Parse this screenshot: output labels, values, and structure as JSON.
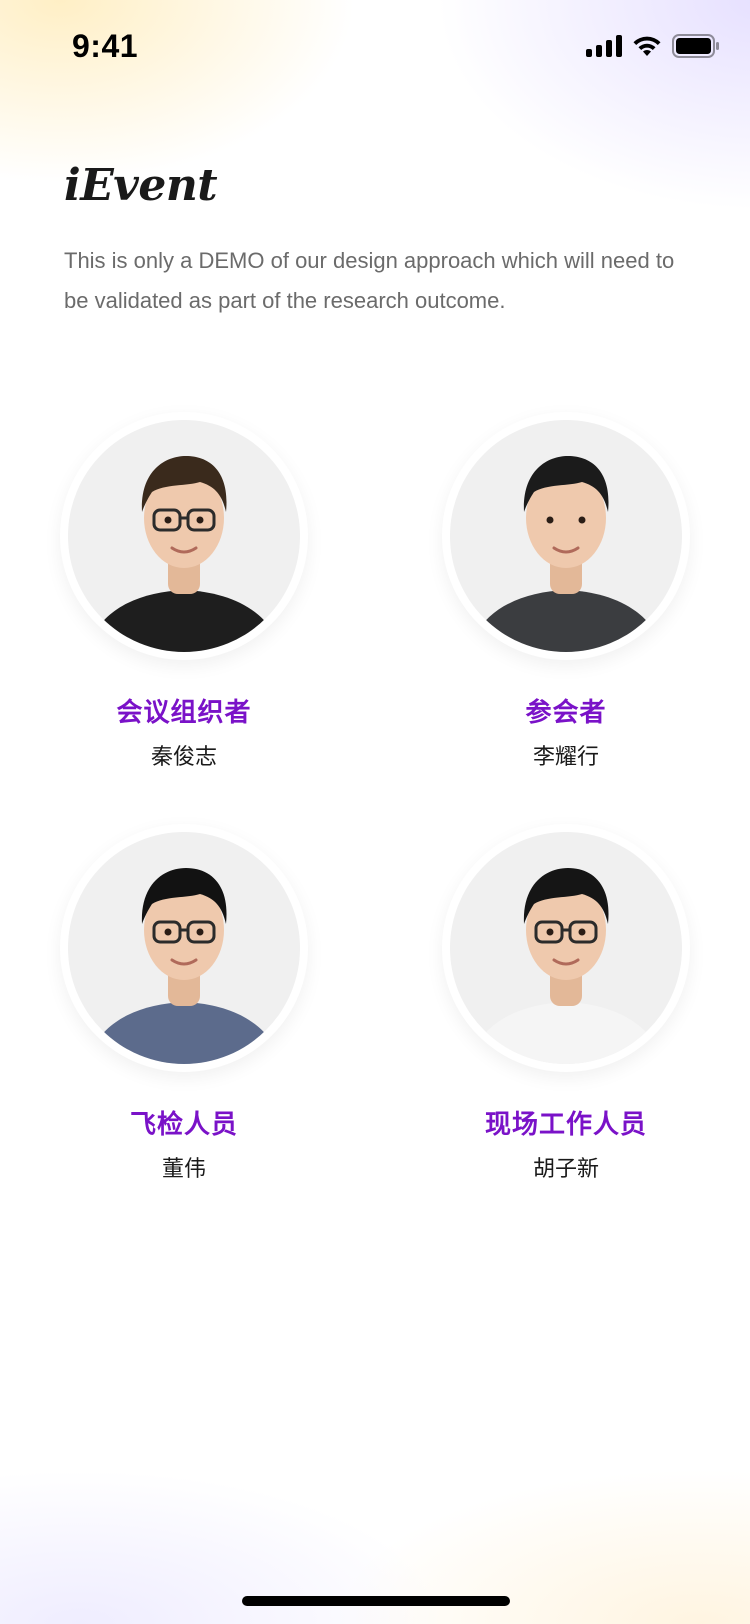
{
  "status_bar": {
    "time": "9:41",
    "icons": [
      "signal-icon",
      "wifi-icon",
      "battery-icon"
    ]
  },
  "header": {
    "app_title": "iEvent",
    "subtitle": "This is only a DEMO of our design approach which will need to be validated as part of the research outcome."
  },
  "roles": [
    {
      "role": "会议组织者",
      "name": "秦俊志",
      "shirt": "#1e1e1e",
      "hair": "#3a2a1c",
      "glasses": true
    },
    {
      "role": "参会者",
      "name": "李耀行",
      "shirt": "#3b3d40",
      "hair": "#1b1b1b",
      "glasses": false
    },
    {
      "role": "飞检人员",
      "name": "董伟",
      "shirt": "#5c6b8c",
      "hair": "#121212",
      "glasses": true
    },
    {
      "role": "现场工作人员",
      "name": "胡子新",
      "shirt": "#f5f5f5",
      "hair": "#151515",
      "glasses": true
    }
  ],
  "colors": {
    "accent": "#7a12c8",
    "text": "#1a1a1a",
    "muted": "#6b6b6b"
  }
}
